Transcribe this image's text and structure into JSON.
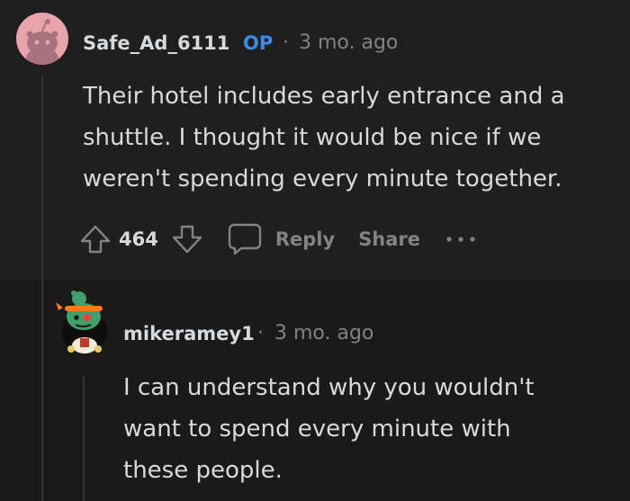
{
  "comments": [
    {
      "username": "Safe_Ad_6111",
      "op_badge": "OP",
      "separator": "·",
      "timestamp": "3 mo. ago",
      "body_lines": [
        "Their hotel includes early entrance and a",
        "shuttle. I thought it would be nice if we",
        "weren't spending every minute together."
      ],
      "votes": "464",
      "reply_label": "Reply",
      "share_label": "Share"
    },
    {
      "username": "mikeramey1",
      "separator": "·",
      "timestamp": "3 mo. ago",
      "body_lines": [
        "I can understand why you wouldn't",
        "want to spend every minute with",
        "these people."
      ]
    }
  ],
  "colors": {
    "op_accent": "#3a8ee6",
    "text": "#d7dadc",
    "muted": "#818384",
    "background": "#1a1a1b"
  }
}
